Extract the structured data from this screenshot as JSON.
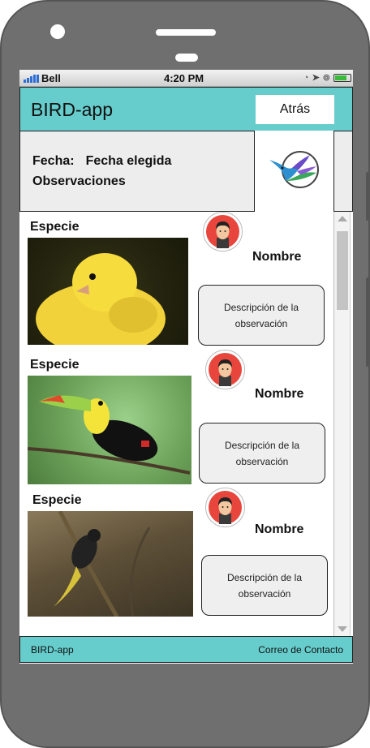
{
  "status": {
    "carrier": "Bell",
    "time": "4:20 PM"
  },
  "header": {
    "title": "BIRD-app",
    "back_label": "Atrás"
  },
  "info": {
    "date_label": "Fecha:",
    "date_value": "Fecha elegida",
    "observations_label": "Observaciones"
  },
  "entries": [
    {
      "species": "Especie",
      "name": "Nombre",
      "description": "Descripción de la observación",
      "image": "yellow-canary-photo"
    },
    {
      "species": "Especie",
      "name": "Nombre",
      "description": "Descripción de la observación",
      "image": "toucan-photo"
    },
    {
      "species": "Especie",
      "name": "Nombre",
      "description": "Descripción de la observación",
      "image": "dark-bird-on-branch-photo"
    }
  ],
  "footer": {
    "left": "BIRD-app",
    "right": "Correo de Contacto"
  },
  "colors": {
    "accent": "#66cccc",
    "panel": "#ededed"
  }
}
